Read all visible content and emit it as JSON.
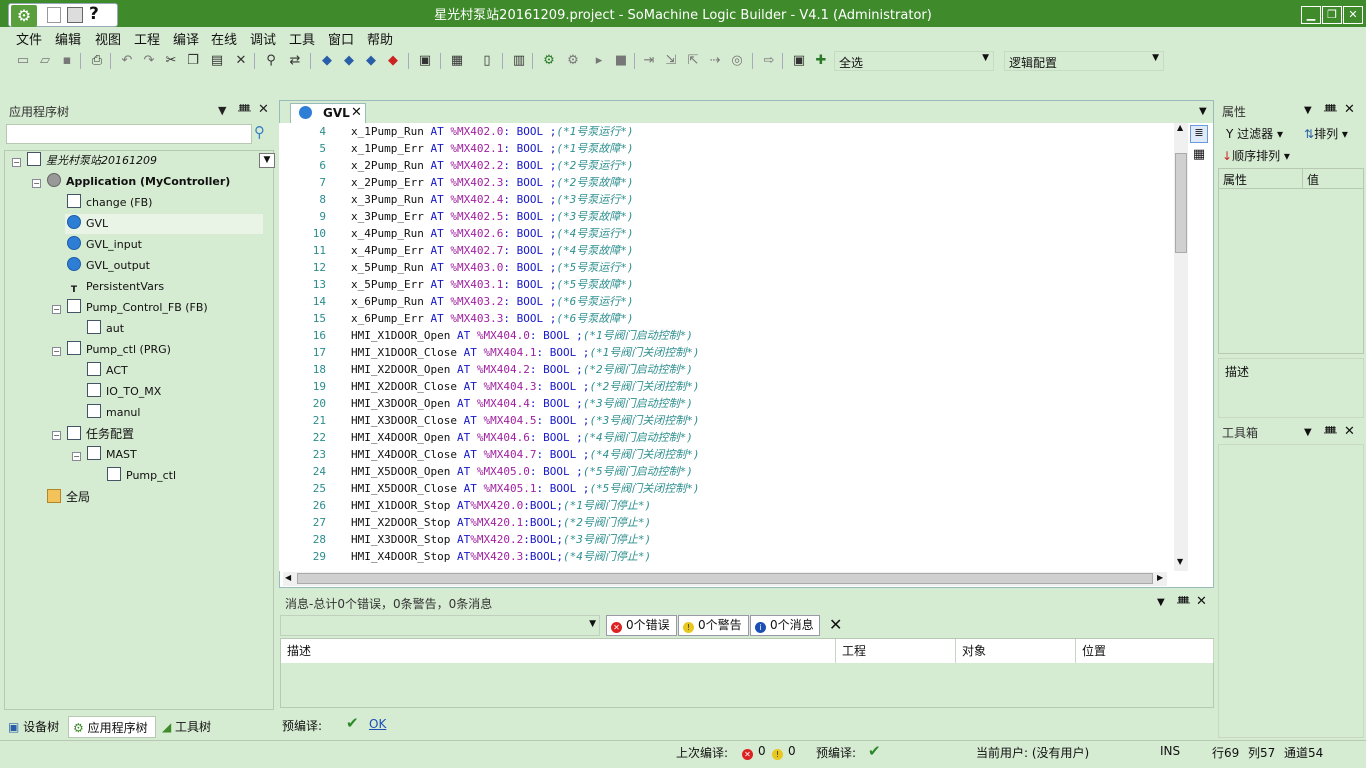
{
  "window": {
    "title": "星光村泵站20161209.project - SoMachine Logic Builder - V4.1 (Administrator)",
    "minimize": "▁",
    "maximize": "❐",
    "close": "✕"
  },
  "quick_access": {
    "help": "?"
  },
  "menu": [
    "文件",
    "编辑",
    "视图",
    "工程",
    "编译",
    "在线",
    "调试",
    "工具",
    "窗口",
    "帮助"
  ],
  "toolbar": {
    "combo1": "全选",
    "combo2": "逻辑配置"
  },
  "app_tree": {
    "title": "应用程序树",
    "search_placeholder": "",
    "nodes": [
      {
        "label": "星光村泵站20161209",
        "icon": "project-icon"
      },
      {
        "label": "Application (MyController)",
        "icon": "gear-icon"
      },
      {
        "label": "change (FB)",
        "icon": "document-icon"
      },
      {
        "label": "GVL",
        "icon": "globe-icon"
      },
      {
        "label": "GVL_input",
        "icon": "globe-icon"
      },
      {
        "label": "GVL_output",
        "icon": "globe-icon"
      },
      {
        "label": "PersistentVars",
        "icon": "pin-icon"
      },
      {
        "label": "Pump_Control_FB (FB)",
        "icon": "document-icon"
      },
      {
        "label": "aut",
        "icon": "action-icon"
      },
      {
        "label": "Pump_ctl (PRG)",
        "icon": "program-icon"
      },
      {
        "label": "ACT",
        "icon": "action-icon"
      },
      {
        "label": "IO_TO_MX",
        "icon": "action-icon"
      },
      {
        "label": "manul",
        "icon": "action-icon"
      },
      {
        "label": "任务配置",
        "icon": "task-config-icon"
      },
      {
        "label": "MAST",
        "icon": "task-icon"
      },
      {
        "label": "Pump_ctl",
        "icon": "call-icon"
      },
      {
        "label": "全局",
        "icon": "folder-icon"
      }
    ]
  },
  "bottom_tabs": [
    "设备树",
    "应用程序树",
    "工具树"
  ],
  "editor": {
    "tab": "GVL",
    "lines": [
      {
        "n": "4",
        "name": "x_1Pump_Run ",
        "at": "AT ",
        "addr": "%MX402.0",
        "ty": ": BOOL ;",
        "cm": "(*1号泵运行*)"
      },
      {
        "n": "5",
        "name": "x_1Pump_Err ",
        "at": "AT ",
        "addr": "%MX402.1",
        "ty": ": BOOL ;",
        "cm": "(*1号泵故障*)"
      },
      {
        "n": "6",
        "name": "x_2Pump_Run ",
        "at": "AT ",
        "addr": "%MX402.2",
        "ty": ": BOOL ;",
        "cm": "(*2号泵运行*)"
      },
      {
        "n": "7",
        "name": "x_2Pump_Err ",
        "at": "AT ",
        "addr": "%MX402.3",
        "ty": ": BOOL ;",
        "cm": "(*2号泵故障*)"
      },
      {
        "n": "8",
        "name": "x_3Pump_Run ",
        "at": "AT ",
        "addr": "%MX402.4",
        "ty": ": BOOL ;",
        "cm": "(*3号泵运行*)"
      },
      {
        "n": "9",
        "name": "x_3Pump_Err ",
        "at": "AT ",
        "addr": "%MX402.5",
        "ty": ": BOOL ;",
        "cm": "(*3号泵故障*)"
      },
      {
        "n": "10",
        "name": "x_4Pump_Run ",
        "at": "AT ",
        "addr": "%MX402.6",
        "ty": ": BOOL ;",
        "cm": "(*4号泵运行*)"
      },
      {
        "n": "11",
        "name": "x_4Pump_Err ",
        "at": "AT ",
        "addr": "%MX402.7",
        "ty": ": BOOL ;",
        "cm": "(*4号泵故障*)"
      },
      {
        "n": "12",
        "name": "x_5Pump_Run ",
        "at": "AT ",
        "addr": "%MX403.0",
        "ty": ": BOOL ;",
        "cm": "(*5号泵运行*)"
      },
      {
        "n": "13",
        "name": "x_5Pump_Err ",
        "at": "AT ",
        "addr": "%MX403.1",
        "ty": ": BOOL ;",
        "cm": "(*5号泵故障*)"
      },
      {
        "n": "14",
        "name": "x_6Pump_Run ",
        "at": "AT ",
        "addr": "%MX403.2",
        "ty": ": BOOL ;",
        "cm": "(*6号泵运行*)"
      },
      {
        "n": "15",
        "name": "x_6Pump_Err ",
        "at": "AT ",
        "addr": "%MX403.3",
        "ty": ": BOOL ;",
        "cm": "(*6号泵故障*)"
      },
      {
        "n": "16",
        "name": "HMI_X1DOOR_Open ",
        "at": "AT ",
        "addr": "%MX404.0",
        "ty": ": BOOL ;",
        "cm": "(*1号阀门启动控制*)"
      },
      {
        "n": "17",
        "name": "HMI_X1DOOR_Close ",
        "at": "AT ",
        "addr": "%MX404.1",
        "ty": ": BOOL ;",
        "cm": "(*1号阀门关闭控制*)"
      },
      {
        "n": "18",
        "name": "HMI_X2DOOR_Open ",
        "at": "AT ",
        "addr": "%MX404.2",
        "ty": ": BOOL ;",
        "cm": "(*2号阀门启动控制*)"
      },
      {
        "n": "19",
        "name": "HMI_X2DOOR_Close ",
        "at": "AT ",
        "addr": "%MX404.3",
        "ty": ": BOOL ;",
        "cm": "(*2号阀门关闭控制*)"
      },
      {
        "n": "20",
        "name": "HMI_X3DOOR_Open ",
        "at": "AT ",
        "addr": "%MX404.4",
        "ty": ": BOOL ;",
        "cm": "(*3号阀门启动控制*)"
      },
      {
        "n": "21",
        "name": "HMI_X3DOOR_Close ",
        "at": "AT ",
        "addr": "%MX404.5",
        "ty": ": BOOL ;",
        "cm": "(*3号阀门关闭控制*)"
      },
      {
        "n": "22",
        "name": "HMI_X4DOOR_Open ",
        "at": "AT ",
        "addr": "%MX404.6",
        "ty": ": BOOL ;",
        "cm": "(*4号阀门启动控制*)"
      },
      {
        "n": "23",
        "name": "HMI_X4DOOR_Close ",
        "at": "AT ",
        "addr": "%MX404.7",
        "ty": ": BOOL ;",
        "cm": "(*4号阀门关闭控制*)"
      },
      {
        "n": "24",
        "name": "HMI_X5DOOR_Open ",
        "at": "AT ",
        "addr": "%MX405.0",
        "ty": ": BOOL ;",
        "cm": "(*5号阀门启动控制*)"
      },
      {
        "n": "25",
        "name": "HMI_X5DOOR_Close ",
        "at": "AT ",
        "addr": "%MX405.1",
        "ty": ": BOOL ;",
        "cm": "(*5号阀门关闭控制*)"
      },
      {
        "n": "26",
        "name": "HMI_X1DOOR_Stop ",
        "at": "AT",
        "addr": "%MX420.0",
        "ty": ":BOOL;",
        "cm": "(*1号阀门停止*)"
      },
      {
        "n": "27",
        "name": "HMI_X2DOOR_Stop ",
        "at": "AT",
        "addr": "%MX420.1",
        "ty": ":BOOL;",
        "cm": "(*2号阀门停止*)"
      },
      {
        "n": "28",
        "name": "HMI_X3DOOR_Stop ",
        "at": "AT",
        "addr": "%MX420.2",
        "ty": ":BOOL;",
        "cm": "(*3号阀门停止*)"
      },
      {
        "n": "29",
        "name": "HMI_X4DOOR_Stop ",
        "at": "AT",
        "addr": "%MX420.3",
        "ty": ":BOOL;",
        "cm": "(*4号阀门停止*)"
      }
    ]
  },
  "messages": {
    "title": "消息-总计0个错误，0条警告，0条消息",
    "errors": "0个错误",
    "warnings": "0个警告",
    "infos": "0个消息",
    "columns": [
      "描述",
      "工程",
      "对象",
      "位置"
    ],
    "precompile_label": "预编译:",
    "precompile_status": "OK"
  },
  "properties": {
    "title": "属性",
    "filter": "过滤器",
    "sort": "排列",
    "order": "顺序排列",
    "col_prop": "属性",
    "col_value": "值",
    "desc": "描述"
  },
  "toolbox": {
    "title": "工具箱"
  },
  "status": {
    "last_compile": "上次编译:",
    "errors": "0",
    "warnings": "0",
    "precompile": "预编译:",
    "user": "当前用户: (没有用户)",
    "ins": "INS",
    "line": "行69",
    "col": "列57",
    "ch": "通道54"
  },
  "colors": {
    "accent": "#3f8a2a",
    "background": "#d6ecd2",
    "keyword": "#1818c8",
    "comment": "#2f8f8f"
  }
}
